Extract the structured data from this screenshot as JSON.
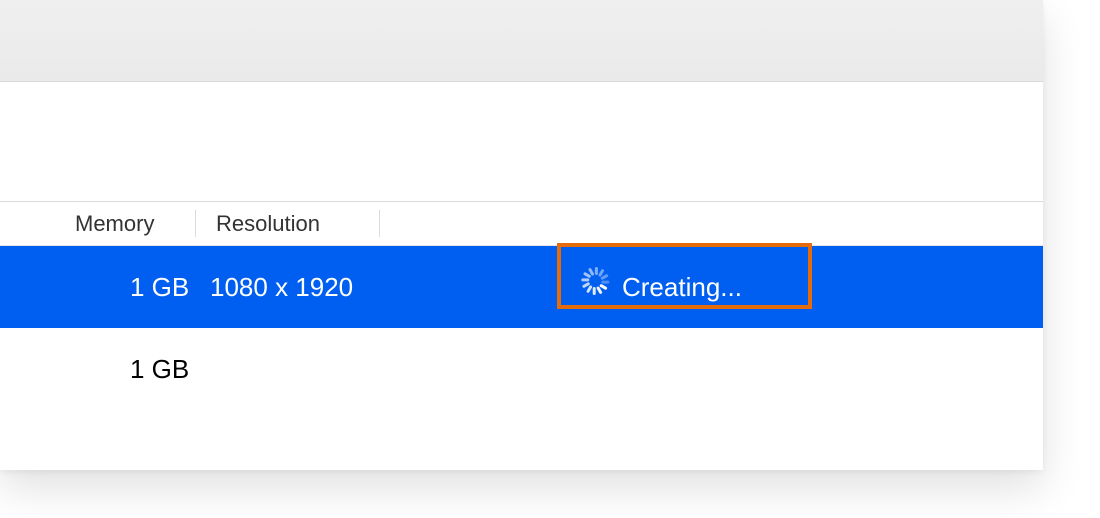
{
  "headers": {
    "memory": "Memory",
    "resolution": "Resolution"
  },
  "rows": [
    {
      "memory": "1 GB",
      "resolution": "1080 x 1920",
      "status": "Creating..."
    },
    {
      "memory": "1 GB",
      "resolution": "",
      "status": ""
    }
  ],
  "colors": {
    "selection": "#005ff1",
    "highlight_border": "#e46c0a"
  }
}
